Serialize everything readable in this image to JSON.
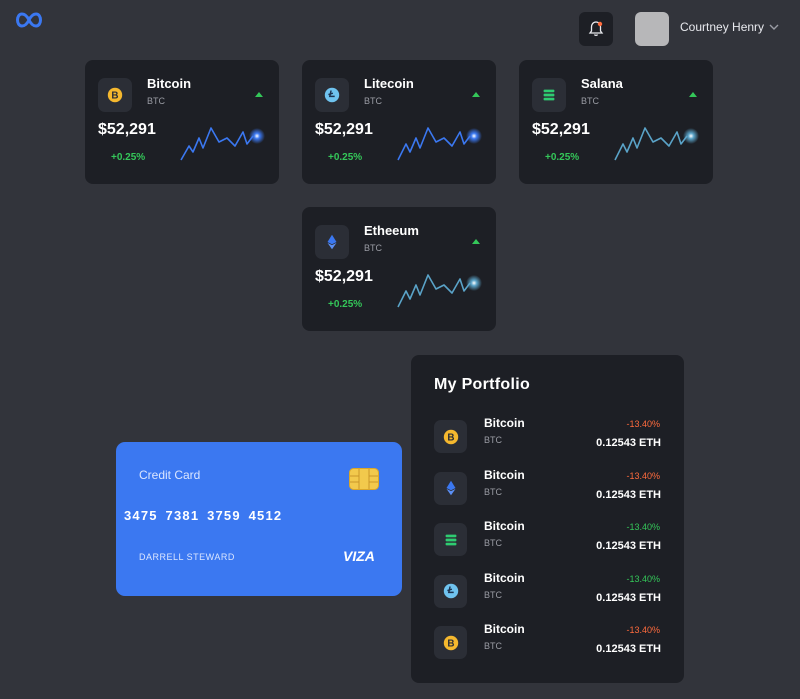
{
  "header": {
    "user_name": "Courtney Henry",
    "icons": [
      "infinity-logo-icon",
      "bell-icon",
      "avatar",
      "chevron-down-icon"
    ]
  },
  "colors": {
    "background": "#32343b",
    "card": "#1d1f25",
    "positive": "#34c759",
    "negative": "#ff6b3d",
    "accent_blue": "#3b78f1"
  },
  "coins": [
    {
      "name": "Bitcoin",
      "symbol": "BTC",
      "price": "$52,291",
      "change": "+0.25%",
      "icon": "bitcoin-icon"
    },
    {
      "name": "Litecoin",
      "symbol": "BTC",
      "price": "$52,291",
      "change": "+0.25%",
      "icon": "litecoin-icon"
    },
    {
      "name": "Salana",
      "symbol": "BTC",
      "price": "$52,291",
      "change": "+0.25%",
      "icon": "solana-icon"
    },
    {
      "name": "Etheeum",
      "symbol": "BTC",
      "price": "$52,291",
      "change": "+0.25%",
      "icon": "ethereum-icon"
    }
  ],
  "portfolio": {
    "title": "My Portfolio",
    "rows": [
      {
        "name": "Bitcoin",
        "symbol": "BTC",
        "change": "-13.40%",
        "amount": "0.12543 ETH",
        "icon": "bitcoin-icon"
      },
      {
        "name": "Bitcoin",
        "symbol": "BTC",
        "change": "-13.40%",
        "amount": "0.12543 ETH",
        "icon": "ethereum-icon"
      },
      {
        "name": "Bitcoin",
        "symbol": "BTC",
        "change": "-13.40%",
        "amount": "0.12543 ETH",
        "icon": "solana-icon"
      },
      {
        "name": "Bitcoin",
        "symbol": "BTC",
        "change": "-13.40%",
        "amount": "0.12543 ETH",
        "icon": "litecoin-icon"
      },
      {
        "name": "Bitcoin",
        "symbol": "BTC",
        "change": "-13.40%",
        "amount": "0.12543 ETH",
        "icon": "bitcoin-icon"
      }
    ],
    "change_colors": [
      "#ff6b3d",
      "#ff6b3d",
      "#34c759",
      "#34c759",
      "#ff6b3d"
    ]
  },
  "credit_card": {
    "title": "Credit Card",
    "number": "3475 7381 3759 4512",
    "holder": "DARRELL STEWARD",
    "brand": "VIZA"
  }
}
